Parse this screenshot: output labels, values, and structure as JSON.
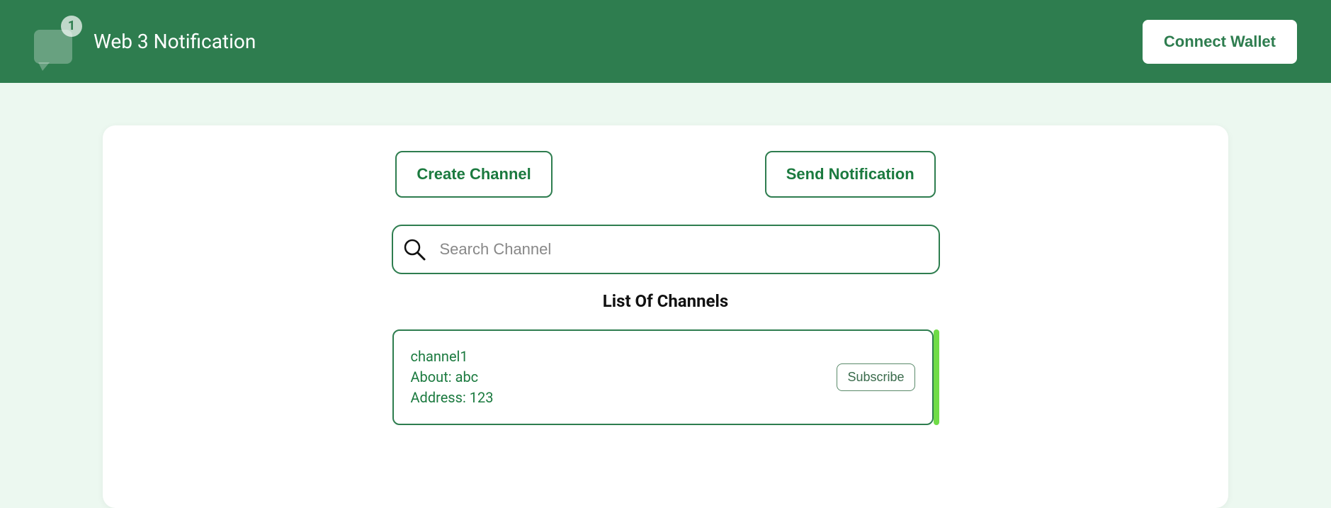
{
  "header": {
    "title": "Web 3 Notification",
    "badge_count": "1",
    "connect_wallet_label": "Connect Wallet"
  },
  "actions": {
    "create_channel_label": "Create Channel",
    "send_notification_label": "Send Notification"
  },
  "search": {
    "placeholder": "Search Channel"
  },
  "list": {
    "title": "List Of Channels"
  },
  "channels": [
    {
      "name": "channel1",
      "about_label": "About: ",
      "about_value": "abc",
      "address_label": "Address: ",
      "address_value": "123",
      "subscribe_label": "Subscribe"
    }
  ]
}
